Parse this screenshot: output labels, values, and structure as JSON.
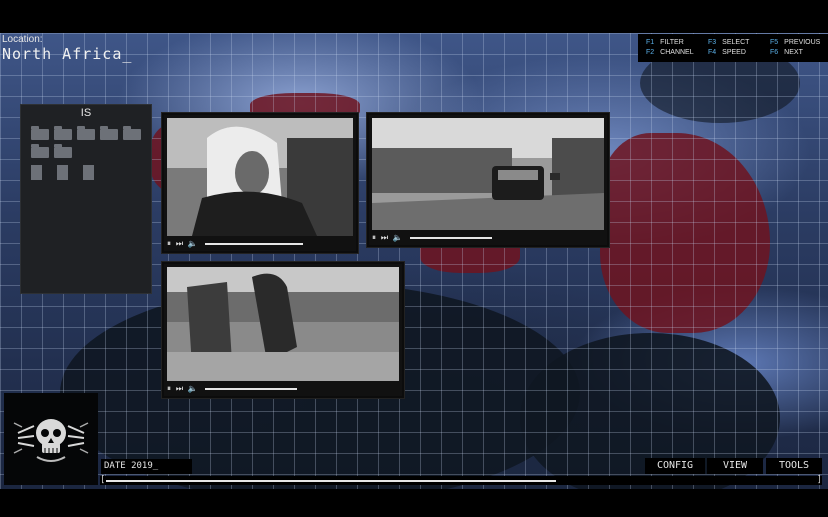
{
  "location": {
    "label": "Location:",
    "value": "North Africa_"
  },
  "keys": [
    {
      "key": "F1",
      "label": "FILTER"
    },
    {
      "key": "F2",
      "label": "CHANNEL"
    },
    {
      "key": "F3",
      "label": "SELECT"
    },
    {
      "key": "F4",
      "label": "SPEED"
    },
    {
      "key": "F5",
      "label": "PREVIOUS"
    },
    {
      "key": "F6",
      "label": "NEXT"
    }
  ],
  "panel": {
    "title": "IS",
    "folder_count": 7,
    "doc_count": 3,
    "folder_color": "#6d7178"
  },
  "videos": [
    {
      "progress": 0.76,
      "controls": "⏸ ⏭ 🔈"
    },
    {
      "progress": 0.42,
      "controls": "⏸ ⏭ 🔈"
    },
    {
      "progress": 0.46,
      "controls": "⏸ ⏭ 🔈"
    }
  ],
  "date": {
    "text": "DATE 2019_"
  },
  "menu": {
    "config": "CONFIG",
    "view": "VIEW",
    "tools": "TOOLS"
  },
  "timeline": {
    "progress": 0.63
  },
  "colors": {
    "highlight_region": "#6e1420",
    "key_accent": "#5bb0e8",
    "map_blue": "#3f5688"
  }
}
